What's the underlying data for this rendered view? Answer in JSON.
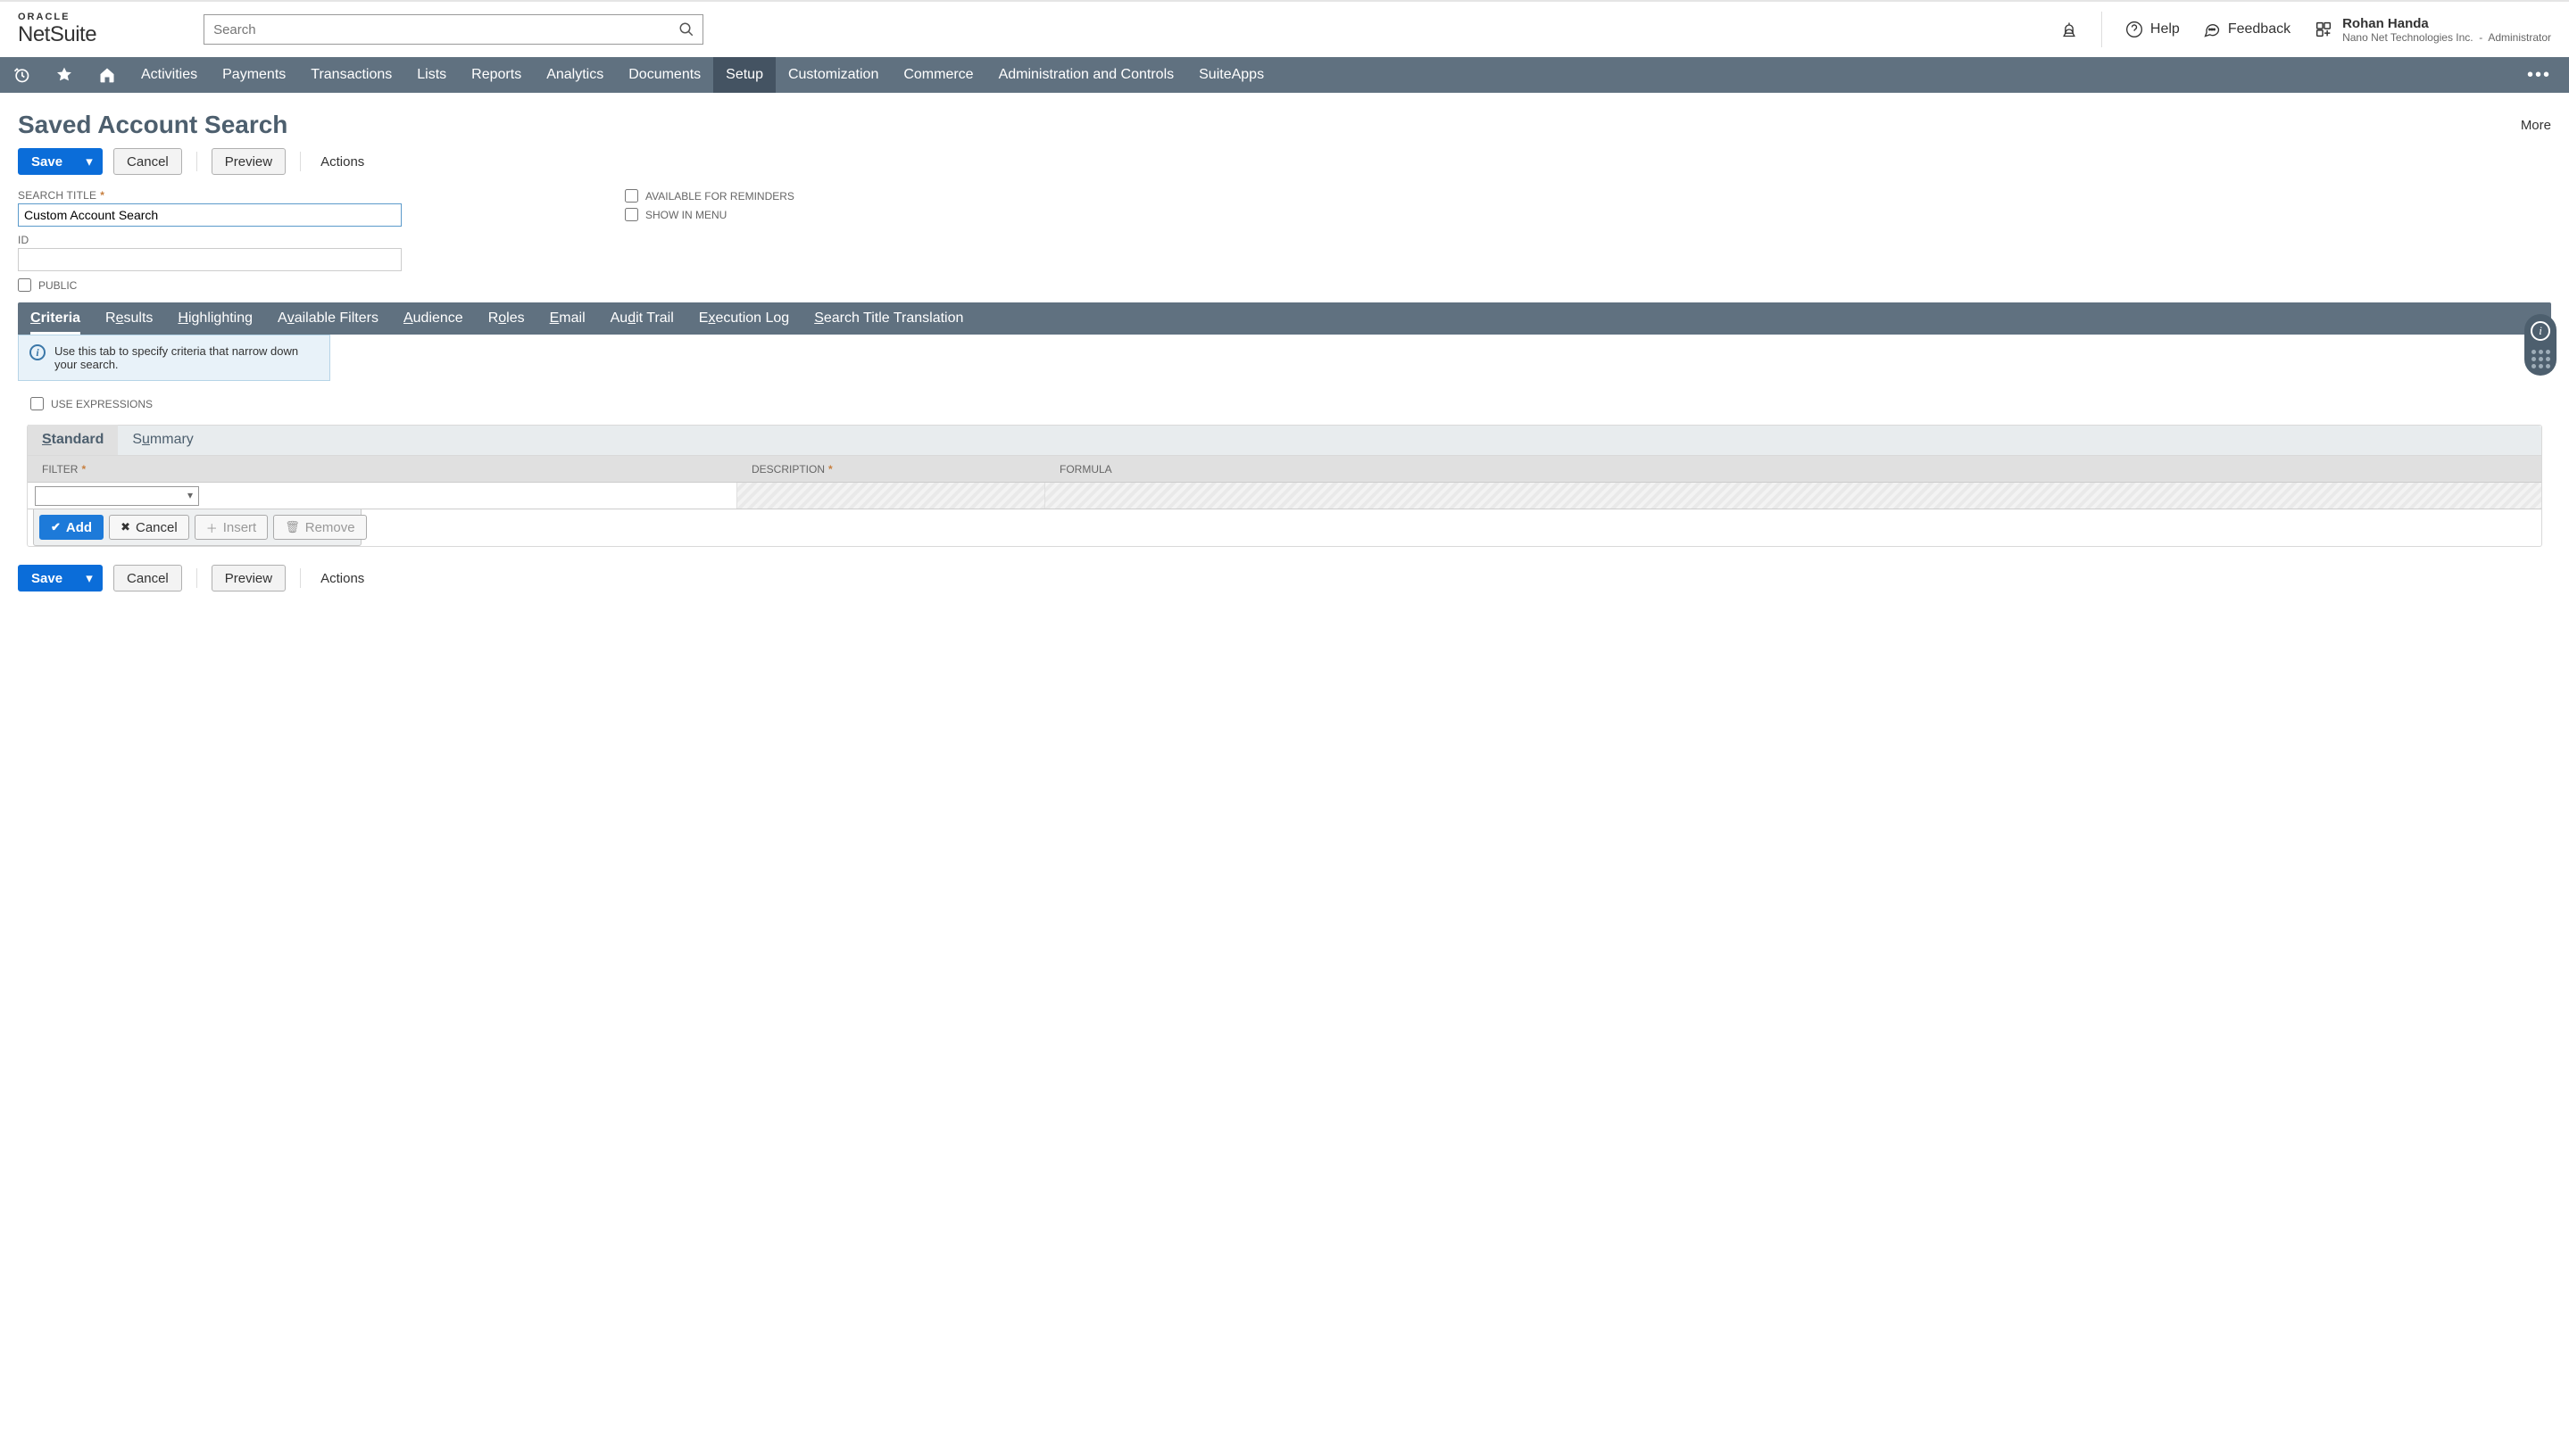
{
  "brand": {
    "oracle": "ORACLE",
    "netsuite": "NetSuite"
  },
  "global_search": {
    "placeholder": "Search"
  },
  "header_actions": {
    "help": "Help",
    "feedback": "Feedback"
  },
  "user": {
    "name": "Rohan Handa",
    "company": "Nano Net Technologies Inc.",
    "role": "Administrator"
  },
  "nav": {
    "items": [
      "Activities",
      "Payments",
      "Transactions",
      "Lists",
      "Reports",
      "Analytics",
      "Documents",
      "Setup",
      "Customization",
      "Commerce",
      "Administration and Controls",
      "SuiteApps"
    ],
    "active_index": 7
  },
  "page": {
    "title": "Saved Account Search",
    "more": "More"
  },
  "actions": {
    "save": "Save",
    "cancel": "Cancel",
    "preview": "Preview",
    "actions": "Actions"
  },
  "form": {
    "search_title_label": "SEARCH TITLE",
    "search_title_value": "Custom Account Search",
    "id_label": "ID",
    "id_value": "",
    "public_label": "PUBLIC",
    "avail_reminders_label": "AVAILABLE FOR REMINDERS",
    "show_in_menu_label": "SHOW IN MENU"
  },
  "subtabs": [
    "Criteria",
    "Results",
    "Highlighting",
    "Available Filters",
    "Audience",
    "Roles",
    "Email",
    "Audit Trail",
    "Execution Log",
    "Search Title Translation"
  ],
  "subtab_ak": [
    "C",
    "e",
    "H",
    "v",
    "A",
    "o",
    "E",
    "d",
    "x",
    "S"
  ],
  "info_text": "Use this tab to specify criteria that narrow down your search.",
  "use_expressions_label": "USE EXPRESSIONS",
  "inner_tabs": {
    "standard": "Standard",
    "summary": "Summary",
    "standard_ak": "S",
    "summary_ak": "u"
  },
  "table": {
    "columns": {
      "filter": "FILTER",
      "description": "DESCRIPTION",
      "formula": "FORMULA"
    }
  },
  "row_actions": {
    "add": "Add",
    "cancel": "Cancel",
    "insert": "Insert",
    "remove": "Remove"
  }
}
